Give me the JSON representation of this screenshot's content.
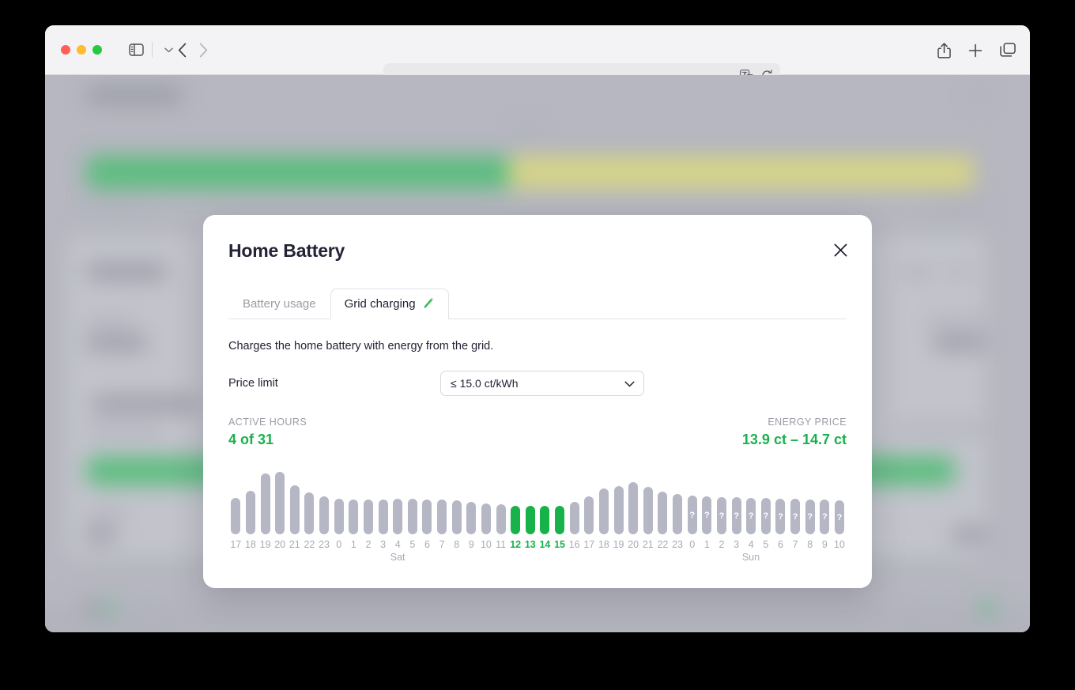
{
  "browser": {
    "name": "Safari",
    "url": "",
    "url_placeholder": "",
    "traffic_lights": [
      "close",
      "minimize",
      "zoom"
    ],
    "icons": {
      "sidebar": "sidebar-icon",
      "sidebar_caret": "chevron-down-icon",
      "back": "back-chevron-icon",
      "forward": "forward-chevron-icon",
      "translate": "translate-icon",
      "reload": "reload-icon",
      "share": "share-icon",
      "new_tab": "plus-icon",
      "tab_overview": "tab-overview-icon"
    }
  },
  "modal": {
    "title": "Home Battery",
    "close_label": "×",
    "tabs": [
      {
        "label": "Battery usage",
        "active": false,
        "icon": null
      },
      {
        "label": "Grid charging",
        "active": true,
        "icon": "lightning-bolt-icon"
      }
    ],
    "description": "Charges the home battery with energy from the grid.",
    "price_limit": {
      "label": "Price limit",
      "value": "≤ 15.0 ct/kWh",
      "options": [
        "≤ 15.0 ct/kWh"
      ]
    },
    "stats": {
      "active_hours": {
        "label": "ACTIVE HOURS",
        "value": "4 of 31"
      },
      "energy_price": {
        "label": "ENERGY PRICE",
        "value": "13.9 ct – 14.7 ct"
      }
    }
  },
  "colors": {
    "accent_green": "#18b24b",
    "bar_inactive": "#b6b7c5",
    "text_dark": "#232336",
    "text_muted": "#9b9ba6"
  },
  "chart_data": {
    "type": "bar",
    "title": "",
    "xlabel": "",
    "ylabel": "",
    "grid": false,
    "legend": null,
    "day_labels": [
      {
        "text": "Sat",
        "index": 11
      },
      {
        "text": "Sun",
        "index": 35
      }
    ],
    "categories": [
      "17",
      "18",
      "19",
      "20",
      "21",
      "22",
      "23",
      "0",
      "1",
      "2",
      "3",
      "4",
      "5",
      "6",
      "7",
      "8",
      "9",
      "10",
      "11",
      "12",
      "13",
      "14",
      "15",
      "16",
      "17",
      "18",
      "19",
      "20",
      "21",
      "22",
      "23",
      "0",
      "1",
      "2",
      "3",
      "4",
      "5",
      "6",
      "7",
      "8",
      "9",
      "10"
    ],
    "values": [
      46,
      55,
      77,
      79,
      62,
      53,
      48,
      45,
      44,
      44,
      44,
      45,
      45,
      44,
      44,
      43,
      41,
      39,
      38,
      36,
      36,
      36,
      36,
      41,
      48,
      58,
      61,
      66,
      60,
      54,
      51,
      49,
      48,
      47,
      47,
      46,
      46,
      45,
      45,
      44,
      44,
      43
    ],
    "active_flags": [
      false,
      false,
      false,
      false,
      false,
      false,
      false,
      false,
      false,
      false,
      false,
      false,
      false,
      false,
      false,
      false,
      false,
      false,
      false,
      true,
      true,
      true,
      true,
      false,
      false,
      false,
      false,
      false,
      false,
      false,
      false,
      false,
      false,
      false,
      false,
      false,
      false,
      false,
      false,
      false,
      false,
      false
    ],
    "unknown_flags": [
      false,
      false,
      false,
      false,
      false,
      false,
      false,
      false,
      false,
      false,
      false,
      false,
      false,
      false,
      false,
      false,
      false,
      false,
      false,
      false,
      false,
      false,
      false,
      false,
      false,
      false,
      false,
      false,
      false,
      false,
      false,
      true,
      true,
      true,
      true,
      true,
      true,
      true,
      true,
      true,
      true,
      true
    ],
    "unknown_marker": "?",
    "ylim": [
      0,
      90
    ]
  }
}
